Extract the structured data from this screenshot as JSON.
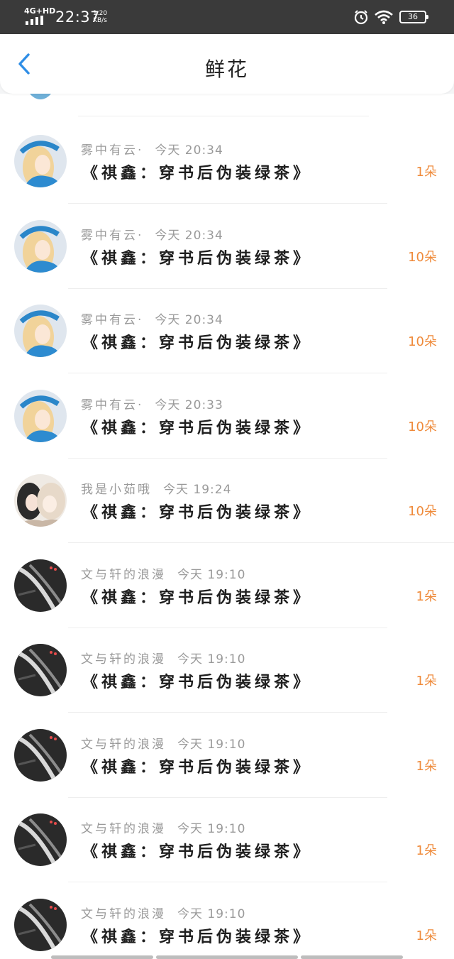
{
  "status_bar": {
    "network": "4G+HD",
    "time": "22:37",
    "speed_value": "1.20",
    "speed_unit": "KB/s",
    "battery": "36",
    "icons": [
      "signal-icon",
      "alarm-icon",
      "wifi-icon",
      "battery-icon"
    ]
  },
  "header": {
    "back_icon": "chevron-left-icon",
    "title": "鲜花"
  },
  "colors": {
    "accent_blue": "#2f8ee6",
    "count_orange": "#ef8a3a",
    "status_bar_bg": "#3a3a3a"
  },
  "gifts": [
    {
      "user": "雾中有云·",
      "time": "今天 20:34",
      "book": "《祺鑫：穿书后伪装绿茶》",
      "count": "1朵",
      "avatar": "blonde-avatar"
    },
    {
      "user": "雾中有云·",
      "time": "今天 20:34",
      "book": "《祺鑫：穿书后伪装绿茶》",
      "count": "10朵",
      "avatar": "blonde-avatar"
    },
    {
      "user": "雾中有云·",
      "time": "今天 20:34",
      "book": "《祺鑫：穿书后伪装绿茶》",
      "count": "10朵",
      "avatar": "blonde-avatar"
    },
    {
      "user": "雾中有云·",
      "time": "今天 20:33",
      "book": "《祺鑫：穿书后伪装绿茶》",
      "count": "10朵",
      "avatar": "blonde-avatar"
    },
    {
      "user": "我是小茹哦",
      "time": "今天 19:24",
      "book": "《祺鑫：穿书后伪装绿茶》",
      "count": "10朵",
      "avatar": "two-girls-avatar"
    },
    {
      "user": "文与轩的浪漫",
      "time": "今天 19:10",
      "book": "《祺鑫：穿书后伪装绿茶》",
      "count": "1朵",
      "avatar": "dark-avatar"
    },
    {
      "user": "文与轩的浪漫",
      "time": "今天 19:10",
      "book": "《祺鑫：穿书后伪装绿茶》",
      "count": "1朵",
      "avatar": "dark-avatar"
    },
    {
      "user": "文与轩的浪漫",
      "time": "今天 19:10",
      "book": "《祺鑫：穿书后伪装绿茶》",
      "count": "1朵",
      "avatar": "dark-avatar"
    },
    {
      "user": "文与轩的浪漫",
      "time": "今天 19:10",
      "book": "《祺鑫：穿书后伪装绿茶》",
      "count": "1朵",
      "avatar": "dark-avatar"
    },
    {
      "user": "文与轩的浪漫",
      "time": "今天 19:10",
      "book": "《祺鑫：穿书后伪装绿茶》",
      "count": "1朵",
      "avatar": "dark-avatar"
    }
  ]
}
